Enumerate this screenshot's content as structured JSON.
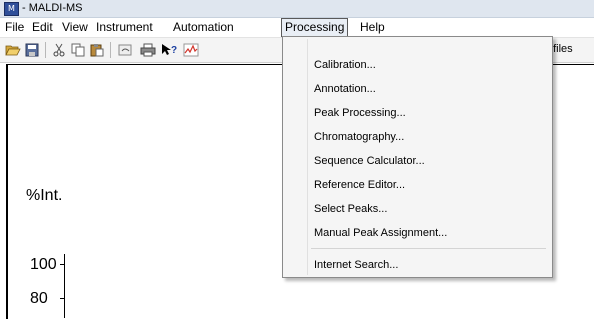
{
  "window": {
    "title": "- MALDI-MS"
  },
  "menubar": {
    "items": [
      "File",
      "Edit",
      "View",
      "Instrument",
      "Automation",
      "Processing",
      "Help"
    ],
    "active": "Processing"
  },
  "toolbar": {
    "buttons": [
      "open-icon",
      "save-icon",
      "cut-icon",
      "copy-icon",
      "paste-icon",
      "undo-icon",
      "print-icon",
      "context-help-icon",
      "spectrum-icon"
    ],
    "profiles_label": "Profiles"
  },
  "processing_menu": {
    "items": [
      "Calibration...",
      "Annotation...",
      "Peak Processing...",
      "Chromatography...",
      "Sequence Calculator...",
      "Reference Editor...",
      "Select Peaks...",
      "Manual Peak Assignment...",
      "Internet Search..."
    ]
  },
  "plot": {
    "y_label": "%Int.",
    "ticks": [
      "100",
      "80"
    ]
  },
  "colors": {
    "menu_highlight": "#e9eef5",
    "menu_bg": "#f5f5f5",
    "toolbar_bg": "#f4f4f4"
  }
}
